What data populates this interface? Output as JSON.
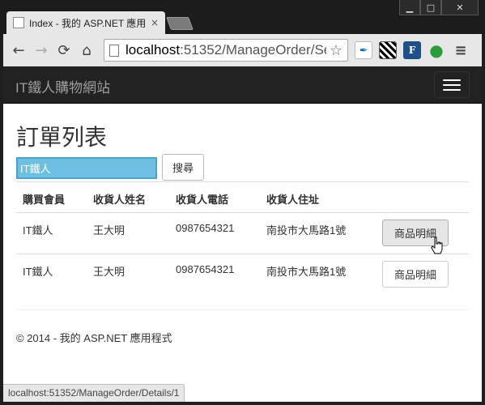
{
  "browser": {
    "tab_title": "Index - 我的 ASP.NET 應用",
    "url_host": "localhost",
    "url_rest": ":51352/ManageOrder/Se",
    "status_url": "localhost:51352/ManageOrder/Details/1",
    "window_buttons": {
      "minimize": "▁",
      "maximize": "□",
      "close": "✕"
    },
    "tab_close": "×",
    "nav": {
      "back": "←",
      "forward": "→",
      "reload": "⟳",
      "home": "⌂"
    },
    "star": "☆",
    "extensions": {
      "a": "✒",
      "f": "F",
      "leaf": "●",
      "menu": "≡"
    }
  },
  "navbar": {
    "brand": "IT鐵人購物網站"
  },
  "main": {
    "title": "訂單列表",
    "search": {
      "value": "IT鐵人",
      "button_label": "搜尋"
    },
    "table": {
      "headers": [
        "購買會員",
        "收貨人姓名",
        "收貨人電話",
        "收貨人住址"
      ],
      "rows": [
        {
          "member": "IT鐵人",
          "name": "王大明",
          "phone": "0987654321",
          "address": "南投市大馬路1號",
          "action": "商品明細"
        },
        {
          "member": "IT鐵人",
          "name": "王大明",
          "phone": "0987654321",
          "address": "南投市大馬路1號",
          "action": "商品明細"
        }
      ]
    }
  },
  "footer": {
    "text": "© 2014 - 我的 ASP.NET 應用程式"
  },
  "colors": {
    "navbar_bg": "#222222",
    "search_highlight": "#6ec0e3",
    "brand_text": "#9d9d9d"
  }
}
